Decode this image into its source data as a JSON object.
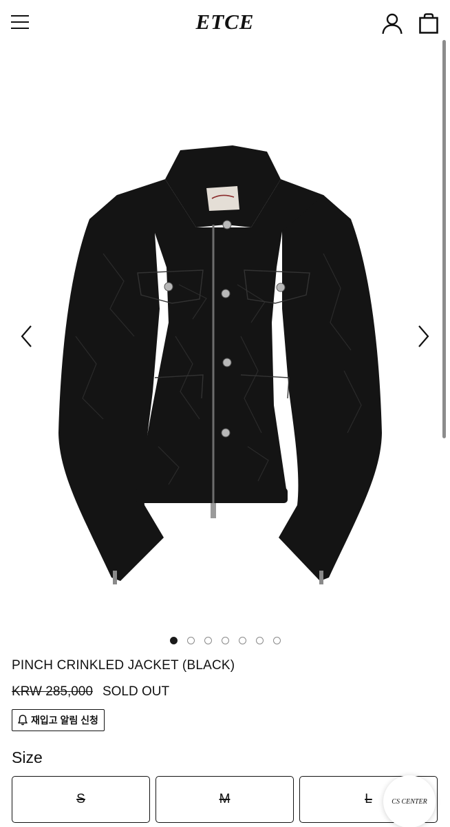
{
  "header": {
    "logo": "ETCE",
    "menu_icon": "hamburger-menu-icon",
    "account_icon": "user-icon",
    "cart_icon": "shopping-bag-icon"
  },
  "gallery": {
    "image": "black crinkled zip jacket",
    "prev_icon": "chevron-left-icon",
    "next_icon": "chevron-right-icon",
    "slide_count": 7,
    "active_slide": 1
  },
  "product": {
    "title": "PINCH CRINKLED JACKET (BLACK)",
    "price": "KRW 285,000",
    "status": "SOLD OUT",
    "restock_button": "재입고 알림 신청",
    "restock_icon": "bell-icon"
  },
  "size": {
    "label": "Size",
    "options": [
      "S",
      "M",
      "L"
    ]
  },
  "cs_center": {
    "label": "CS CENTER"
  },
  "colors": {
    "text": "#111111",
    "background": "#ffffff",
    "jacket": "#141414"
  }
}
